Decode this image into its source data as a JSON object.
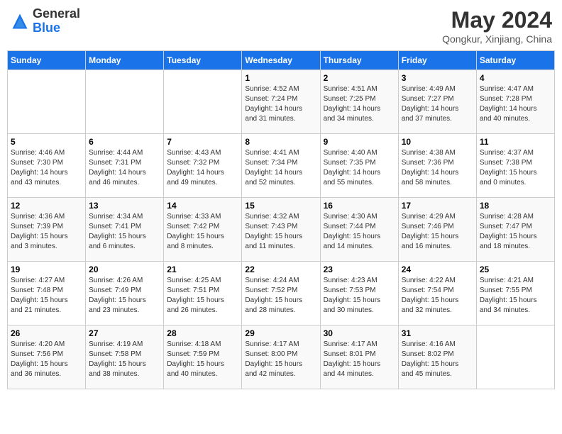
{
  "header": {
    "logo_general": "General",
    "logo_blue": "Blue",
    "month_year": "May 2024",
    "location": "Qongkur, Xinjiang, China"
  },
  "weekdays": [
    "Sunday",
    "Monday",
    "Tuesday",
    "Wednesday",
    "Thursday",
    "Friday",
    "Saturday"
  ],
  "weeks": [
    [
      {
        "day": "",
        "info": ""
      },
      {
        "day": "",
        "info": ""
      },
      {
        "day": "",
        "info": ""
      },
      {
        "day": "1",
        "info": "Sunrise: 4:52 AM\nSunset: 7:24 PM\nDaylight: 14 hours\nand 31 minutes."
      },
      {
        "day": "2",
        "info": "Sunrise: 4:51 AM\nSunset: 7:25 PM\nDaylight: 14 hours\nand 34 minutes."
      },
      {
        "day": "3",
        "info": "Sunrise: 4:49 AM\nSunset: 7:27 PM\nDaylight: 14 hours\nand 37 minutes."
      },
      {
        "day": "4",
        "info": "Sunrise: 4:47 AM\nSunset: 7:28 PM\nDaylight: 14 hours\nand 40 minutes."
      }
    ],
    [
      {
        "day": "5",
        "info": "Sunrise: 4:46 AM\nSunset: 7:30 PM\nDaylight: 14 hours\nand 43 minutes."
      },
      {
        "day": "6",
        "info": "Sunrise: 4:44 AM\nSunset: 7:31 PM\nDaylight: 14 hours\nand 46 minutes."
      },
      {
        "day": "7",
        "info": "Sunrise: 4:43 AM\nSunset: 7:32 PM\nDaylight: 14 hours\nand 49 minutes."
      },
      {
        "day": "8",
        "info": "Sunrise: 4:41 AM\nSunset: 7:34 PM\nDaylight: 14 hours\nand 52 minutes."
      },
      {
        "day": "9",
        "info": "Sunrise: 4:40 AM\nSunset: 7:35 PM\nDaylight: 14 hours\nand 55 minutes."
      },
      {
        "day": "10",
        "info": "Sunrise: 4:38 AM\nSunset: 7:36 PM\nDaylight: 14 hours\nand 58 minutes."
      },
      {
        "day": "11",
        "info": "Sunrise: 4:37 AM\nSunset: 7:38 PM\nDaylight: 15 hours\nand 0 minutes."
      }
    ],
    [
      {
        "day": "12",
        "info": "Sunrise: 4:36 AM\nSunset: 7:39 PM\nDaylight: 15 hours\nand 3 minutes."
      },
      {
        "day": "13",
        "info": "Sunrise: 4:34 AM\nSunset: 7:41 PM\nDaylight: 15 hours\nand 6 minutes."
      },
      {
        "day": "14",
        "info": "Sunrise: 4:33 AM\nSunset: 7:42 PM\nDaylight: 15 hours\nand 8 minutes."
      },
      {
        "day": "15",
        "info": "Sunrise: 4:32 AM\nSunset: 7:43 PM\nDaylight: 15 hours\nand 11 minutes."
      },
      {
        "day": "16",
        "info": "Sunrise: 4:30 AM\nSunset: 7:44 PM\nDaylight: 15 hours\nand 14 minutes."
      },
      {
        "day": "17",
        "info": "Sunrise: 4:29 AM\nSunset: 7:46 PM\nDaylight: 15 hours\nand 16 minutes."
      },
      {
        "day": "18",
        "info": "Sunrise: 4:28 AM\nSunset: 7:47 PM\nDaylight: 15 hours\nand 18 minutes."
      }
    ],
    [
      {
        "day": "19",
        "info": "Sunrise: 4:27 AM\nSunset: 7:48 PM\nDaylight: 15 hours\nand 21 minutes."
      },
      {
        "day": "20",
        "info": "Sunrise: 4:26 AM\nSunset: 7:49 PM\nDaylight: 15 hours\nand 23 minutes."
      },
      {
        "day": "21",
        "info": "Sunrise: 4:25 AM\nSunset: 7:51 PM\nDaylight: 15 hours\nand 26 minutes."
      },
      {
        "day": "22",
        "info": "Sunrise: 4:24 AM\nSunset: 7:52 PM\nDaylight: 15 hours\nand 28 minutes."
      },
      {
        "day": "23",
        "info": "Sunrise: 4:23 AM\nSunset: 7:53 PM\nDaylight: 15 hours\nand 30 minutes."
      },
      {
        "day": "24",
        "info": "Sunrise: 4:22 AM\nSunset: 7:54 PM\nDaylight: 15 hours\nand 32 minutes."
      },
      {
        "day": "25",
        "info": "Sunrise: 4:21 AM\nSunset: 7:55 PM\nDaylight: 15 hours\nand 34 minutes."
      }
    ],
    [
      {
        "day": "26",
        "info": "Sunrise: 4:20 AM\nSunset: 7:56 PM\nDaylight: 15 hours\nand 36 minutes."
      },
      {
        "day": "27",
        "info": "Sunrise: 4:19 AM\nSunset: 7:58 PM\nDaylight: 15 hours\nand 38 minutes."
      },
      {
        "day": "28",
        "info": "Sunrise: 4:18 AM\nSunset: 7:59 PM\nDaylight: 15 hours\nand 40 minutes."
      },
      {
        "day": "29",
        "info": "Sunrise: 4:17 AM\nSunset: 8:00 PM\nDaylight: 15 hours\nand 42 minutes."
      },
      {
        "day": "30",
        "info": "Sunrise: 4:17 AM\nSunset: 8:01 PM\nDaylight: 15 hours\nand 44 minutes."
      },
      {
        "day": "31",
        "info": "Sunrise: 4:16 AM\nSunset: 8:02 PM\nDaylight: 15 hours\nand 45 minutes."
      },
      {
        "day": "",
        "info": ""
      }
    ]
  ]
}
